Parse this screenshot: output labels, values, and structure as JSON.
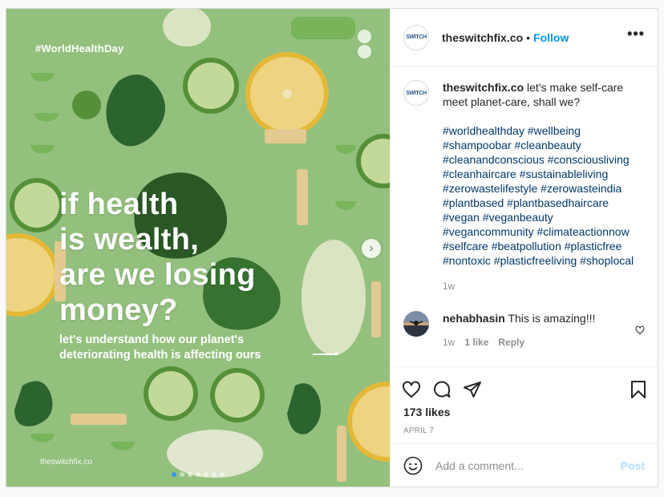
{
  "media": {
    "tag": "#WorldHealthDay",
    "headline": [
      "if health",
      "is wealth,",
      "are we losing",
      "money?"
    ],
    "subtext": [
      "let's understand how our planet's",
      "deteriorating health is affecting ours"
    ],
    "watermark": "theswitchfix.co",
    "next_glyph": "›",
    "carousel": {
      "count": 7,
      "active_index": 0
    }
  },
  "account": {
    "avatar_text": "SWITCH",
    "username": "theswitchfix.co",
    "separator": "•",
    "follow_label": "Follow",
    "more_glyph": "•••"
  },
  "caption": {
    "username": "theswitchfix.co",
    "text": "let's make self-care meet planet-care, shall we?",
    "hashtag_lines": [
      "#worldhealthday #wellbeing",
      "#shampoobar #cleanbeauty",
      "#cleanandconscious #consciousliving",
      "#cleanhaircare #sustainableliving",
      "#zerowastelifestyle #zerowasteindia",
      "#plantbased #plantbasedhaircare",
      "#vegan #veganbeauty",
      "#vegancommunity #climateactionnow",
      "#selfcare #beatpollution #plasticfree",
      "#nontoxic #plasticfreeliving #shoplocal"
    ],
    "time": "1w"
  },
  "reply": {
    "username": "nehabhasin",
    "text": "This is amazing!!!",
    "time": "1w",
    "likes": "1 like",
    "reply_label": "Reply"
  },
  "actions": {
    "icons": [
      "heart-icon",
      "comment-icon",
      "share-icon",
      "bookmark-icon"
    ],
    "likes_text": "173 likes",
    "date": "APRIL 7"
  },
  "comment_box": {
    "placeholder": "Add a comment...",
    "post_label": "Post"
  },
  "colors": {
    "link": "#0095f6",
    "hashtag": "#00376b",
    "muted": "#8e8e8e",
    "post_disabled": "#b2dffc",
    "image_bg": "#a5d28f"
  }
}
